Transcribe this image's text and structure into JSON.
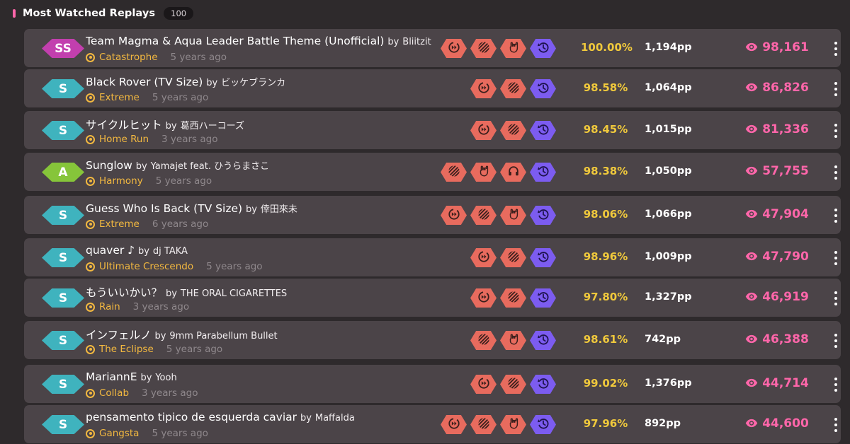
{
  "header": {
    "title": "Most Watched Replays",
    "count": "100"
  },
  "colors": {
    "background": "#2e2a2c",
    "row": "#4b4448",
    "accent": "#ff66aa",
    "accuracy": "#f0c93c",
    "difficulty": "#f2b840",
    "mod_red": "#e86b5e",
    "mod_purple": "#7c5cf0",
    "grade_ss": "#c23fae",
    "grade_s": "#3fb3be",
    "grade_a": "#86c53a"
  },
  "replays": [
    {
      "grade": "SS",
      "title": "Team Magma & Aqua Leader Battle Theme (Unofficial)",
      "by": "by",
      "artist": "Bliitzit",
      "difficulty": "Catastrophe",
      "time_ago": "5 years ago",
      "mods": [
        "double-time-icon",
        "hidden-icon",
        "sudden-death-icon",
        "flashlight-icon"
      ],
      "accuracy": "100.00%",
      "pp": "1,194pp",
      "views": "98,161"
    },
    {
      "grade": "S",
      "title": "Black Rover (TV Size)",
      "by": "by",
      "artist": "ビッケブランカ",
      "difficulty": "Extreme",
      "time_ago": "5 years ago",
      "mods": [
        "double-time-icon",
        "hidden-icon",
        "flashlight-icon"
      ],
      "accuracy": "98.58%",
      "pp": "1,064pp",
      "views": "86,826"
    },
    {
      "grade": "S",
      "title": "サイクルヒット",
      "by": "by",
      "artist": "葛西ハーコーズ",
      "difficulty": "Home Run",
      "time_ago": "3 years ago",
      "mods": [
        "double-time-icon",
        "hidden-icon",
        "flashlight-icon"
      ],
      "accuracy": "98.45%",
      "pp": "1,015pp",
      "views": "81,336"
    },
    {
      "grade": "A",
      "title": "Sunglow",
      "by": "by",
      "artist": "Yamajet feat. ひうらまさこ",
      "difficulty": "Harmony",
      "time_ago": "5 years ago",
      "mods": [
        "hidden-icon",
        "sudden-death-icon",
        "relax-icon",
        "flashlight-icon"
      ],
      "accuracy": "98.38%",
      "pp": "1,050pp",
      "views": "57,755"
    },
    {
      "grade": "S",
      "title": "Guess Who Is Back (TV Size)",
      "by": "by",
      "artist": "倖田來未",
      "difficulty": "Extreme",
      "time_ago": "6 years ago",
      "mods": [
        "double-time-icon",
        "hidden-icon",
        "sudden-death-icon",
        "flashlight-icon"
      ],
      "accuracy": "98.06%",
      "pp": "1,066pp",
      "views": "47,904"
    },
    {
      "grade": "S",
      "title": "quaver ♪",
      "by": "by",
      "artist": "dj TAKA",
      "difficulty": "Ultimate Crescendo",
      "time_ago": "5 years ago",
      "mods": [
        "double-time-icon",
        "hidden-icon",
        "flashlight-icon"
      ],
      "accuracy": "98.96%",
      "pp": "1,009pp",
      "views": "47,790"
    },
    {
      "grade": "S",
      "title": "もういいかい？",
      "by": "by",
      "artist": "THE ORAL CIGARETTES",
      "difficulty": "Rain",
      "time_ago": "3 years ago",
      "mods": [
        "double-time-icon",
        "hidden-icon",
        "flashlight-icon"
      ],
      "accuracy": "97.80%",
      "pp": "1,327pp",
      "views": "46,919"
    },
    {
      "grade": "S",
      "title": "インフェルノ",
      "by": "by",
      "artist": "9mm Parabellum Bullet",
      "difficulty": "The Eclipse",
      "time_ago": "5 years ago",
      "mods": [
        "hidden-icon",
        "sudden-death-icon",
        "flashlight-icon"
      ],
      "accuracy": "98.61%",
      "pp": "742pp",
      "views": "46,388"
    },
    {
      "grade": "S",
      "title": "MariannE",
      "by": "by",
      "artist": "Yooh",
      "difficulty": "Collab",
      "time_ago": "3 years ago",
      "mods": [
        "double-time-icon",
        "hidden-icon",
        "flashlight-icon"
      ],
      "accuracy": "99.02%",
      "pp": "1,376pp",
      "views": "44,714"
    },
    {
      "grade": "S",
      "title": "pensamento tipico de esquerda caviar",
      "by": "by",
      "artist": "Maffalda",
      "difficulty": "Gangsta",
      "time_ago": "5 years ago",
      "mods": [
        "double-time-icon",
        "hidden-icon",
        "sudden-death-icon",
        "flashlight-icon"
      ],
      "accuracy": "97.96%",
      "pp": "892pp",
      "views": "44,600"
    }
  ]
}
